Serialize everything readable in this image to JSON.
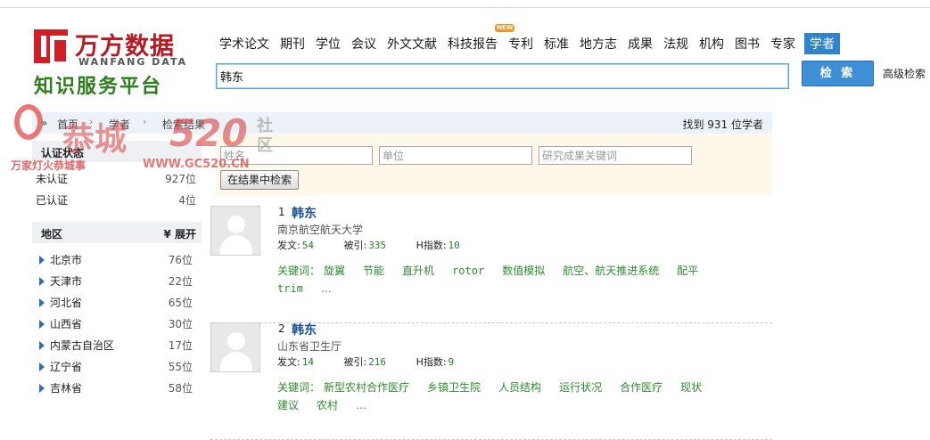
{
  "logo": {
    "name_cn": "万方数据",
    "name_en": "WANFANG DATA",
    "tagline": "知识服务平台"
  },
  "nav": {
    "items": [
      "学术论文",
      "期刊",
      "学位",
      "会议",
      "外文文献",
      "科技报告",
      "专利",
      "标准",
      "地方志",
      "成果",
      "法规",
      "机构",
      "图书",
      "专家",
      "学者"
    ],
    "new_badge": "NEW",
    "active": "学者"
  },
  "search": {
    "query": "韩东",
    "button": "检 索",
    "advanced": "高级检索"
  },
  "breadcrumb": {
    "prefix": "»",
    "home": "首页",
    "scholar": "学者",
    "results": "检索结果",
    "found": "找到 931 位学者"
  },
  "refine": {
    "name_placeholder": "姓名",
    "org_placeholder": "单位",
    "keyword_placeholder": "研究成果关键词",
    "button": "在结果中检索"
  },
  "sidebar": {
    "cert_title": "认证状态",
    "cert": [
      {
        "label": "未认证",
        "count": "927位"
      },
      {
        "label": "已认证",
        "count": "4位"
      }
    ],
    "region_title": "地区",
    "expand": "展开",
    "regions": [
      {
        "label": "北京市",
        "count": "76位"
      },
      {
        "label": "天津市",
        "count": "22位"
      },
      {
        "label": "河北省",
        "count": "65位"
      },
      {
        "label": "山西省",
        "count": "30位"
      },
      {
        "label": "内蒙古自治区",
        "count": "17位"
      },
      {
        "label": "辽宁省",
        "count": "55位"
      },
      {
        "label": "吉林省",
        "count": "58位"
      }
    ]
  },
  "results": [
    {
      "num": "1",
      "name": "韩东",
      "org": "南京航空航天大学",
      "pubs_label": "发文:",
      "pubs": "54",
      "cites_label": "被引:",
      "cites": "335",
      "h_label": "H指数:",
      "h": "10",
      "kw_label": "关键词：",
      "keywords": [
        "旋翼",
        "节能",
        "直升机",
        "rotor",
        "数值模拟",
        "航空、航天推进系统",
        "配平",
        "trim",
        "…"
      ]
    },
    {
      "num": "2",
      "name": "韩东",
      "org": "山东省卫生厅",
      "pubs_label": "发文:",
      "pubs": "14",
      "cites_label": "被引:",
      "cites": "216",
      "h_label": "H指数:",
      "h": "9",
      "kw_label": "关键词：",
      "keywords": [
        "新型农村合作医疗",
        "乡镇卫生院",
        "人员结构",
        "运行状况",
        "合作医疗",
        "现状",
        "建议",
        "农村",
        "…"
      ]
    }
  ],
  "watermark": {
    "big": "恭城",
    "num": "520",
    "she": "社",
    "qu": "区",
    "sub": "万家灯火恭城事",
    "url": "WWW.GC520.CN"
  },
  "colors": {
    "brand_red": "#d01f26",
    "brand_green": "#2e7d1e",
    "accent_blue": "#2f84cc",
    "keyword_green": "#2e8b2e"
  }
}
